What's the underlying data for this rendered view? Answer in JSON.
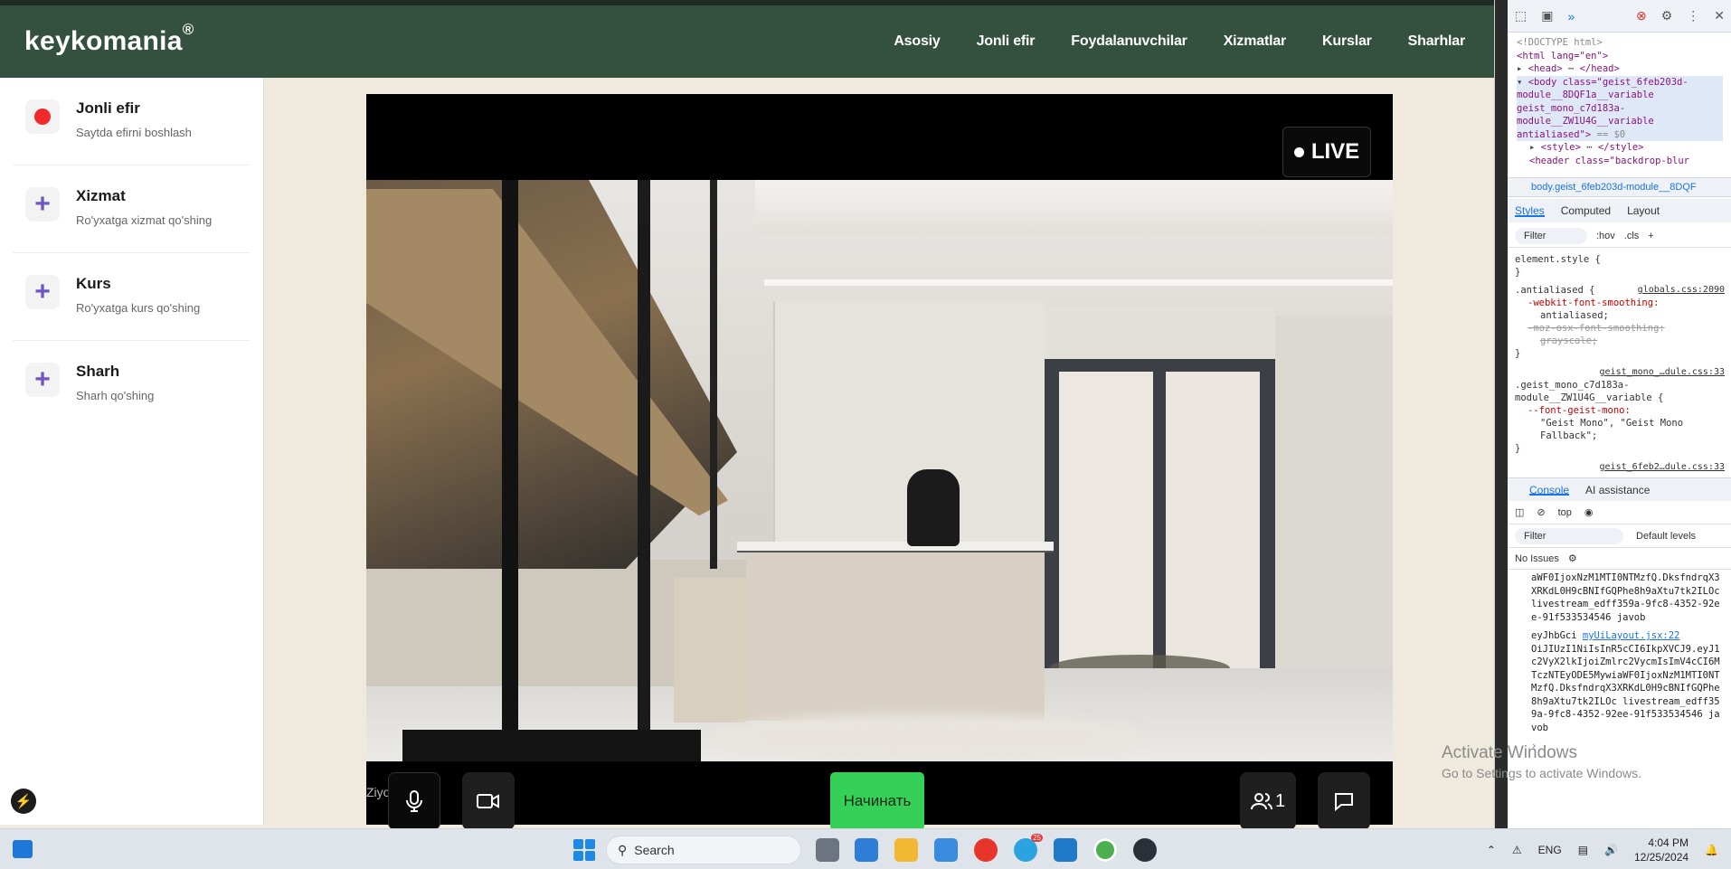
{
  "app": {
    "brand": "keykomania",
    "brand_mark": "®",
    "nav": [
      "Asosiy",
      "Jonli efir",
      "Foydalanuvchilar",
      "Xizmatlar",
      "Kurslar",
      "Sharhlar"
    ]
  },
  "sidebar": {
    "items": [
      {
        "title": "Jonli efir",
        "subtitle": "Saytda efirni boshlash",
        "icon": "record-dot-icon"
      },
      {
        "title": "Xizmat",
        "subtitle": "Ro'yxatga xizmat qo'shing",
        "icon": "plus-icon"
      },
      {
        "title": "Kurs",
        "subtitle": "Ro'yxatga kurs qo'shing",
        "icon": "plus-icon"
      },
      {
        "title": "Sharh",
        "subtitle": "Sharh qo'shing",
        "icon": "plus-icon"
      }
    ]
  },
  "stream": {
    "live_label": "LIVE",
    "start_label": "Начинать",
    "participants": "1",
    "name_tag": "Ziyodaxon"
  },
  "devtools": {
    "lines": [
      "<!DOCTYPE html>",
      "<html lang=\"en\">",
      "<head>",
      "</head>",
      "<body class=\"geist_6feb203d-module__8DQF1a__variable geist_mono_c7d183a-module__ZW1U4G__variable antialiased\">",
      "== $0",
      "<style>",
      "</style>",
      "<header class=\"backdrop-blur"
    ],
    "breadcrumb": "body.geist_6feb203d-module__8DQF",
    "tabs": [
      "Styles",
      "Computed",
      "Layout"
    ],
    "filter": "Filter",
    "hov": ":hov",
    "cls": ".cls",
    "element_style": "element.style {",
    "rule1_selector": ".antialiased {",
    "rule1_source": "globals.css:2090",
    "rule1_p1": "-webkit-font-smoothing:",
    "rule1_v1": "antialiased;",
    "rule1_p2": "-moz-osx-font-smoothing:",
    "rule1_v2": "grayscale;",
    "rule2_source": "geist_mono_…dule.css:33",
    "rule2_selector": ".geist_mono_c7d183a-module__ZW1U4G__variable {",
    "rule2_p": "--font-geist-mono:",
    "rule2_v": "\"Geist Mono\", \"Geist Mono Fallback\";",
    "rule3_source": "geist_6feb2…dule.css:33",
    "console_tabs": [
      "Console",
      "AI assistance"
    ],
    "context": "top",
    "levels": "Default levels",
    "issues": "No Issues",
    "log1": "aWF0IjoxNzM1MTI0NTMzfQ.DksfndrqX3XRKdL0H9cBNIfGQPhe8h9aXtu7tk2ILOc livestream_edff359a-9fc8-4352-92ee-91f533534546 javob",
    "log2_prefix": "eyJhbGci",
    "log2_source": "myUiLayout.jsx:22",
    "log2": "OiJIUzI1NiIsInR5cCI6IkpXVCJ9.eyJ1c2VyX2lkIjoiZmlrc2VycmIsImV4cCI6MTczNTEyODE5MywiaWF0IjoxNzM1MTI0NTMzfQ.DksfndrqX3XRKdL0H9cBNIfGQPhe8h9aXtu7tk2ILOc livestream_edff359a-9fc8-4352-92ee-91f533534546 javob"
  },
  "watermark": {
    "line1": "Activate Windows",
    "line2": "Go to Settings to activate Windows."
  },
  "taskbar": {
    "search": "Search",
    "lang": "ENG",
    "time": "4:04 PM",
    "date": "12/25/2024",
    "badge": "25"
  }
}
